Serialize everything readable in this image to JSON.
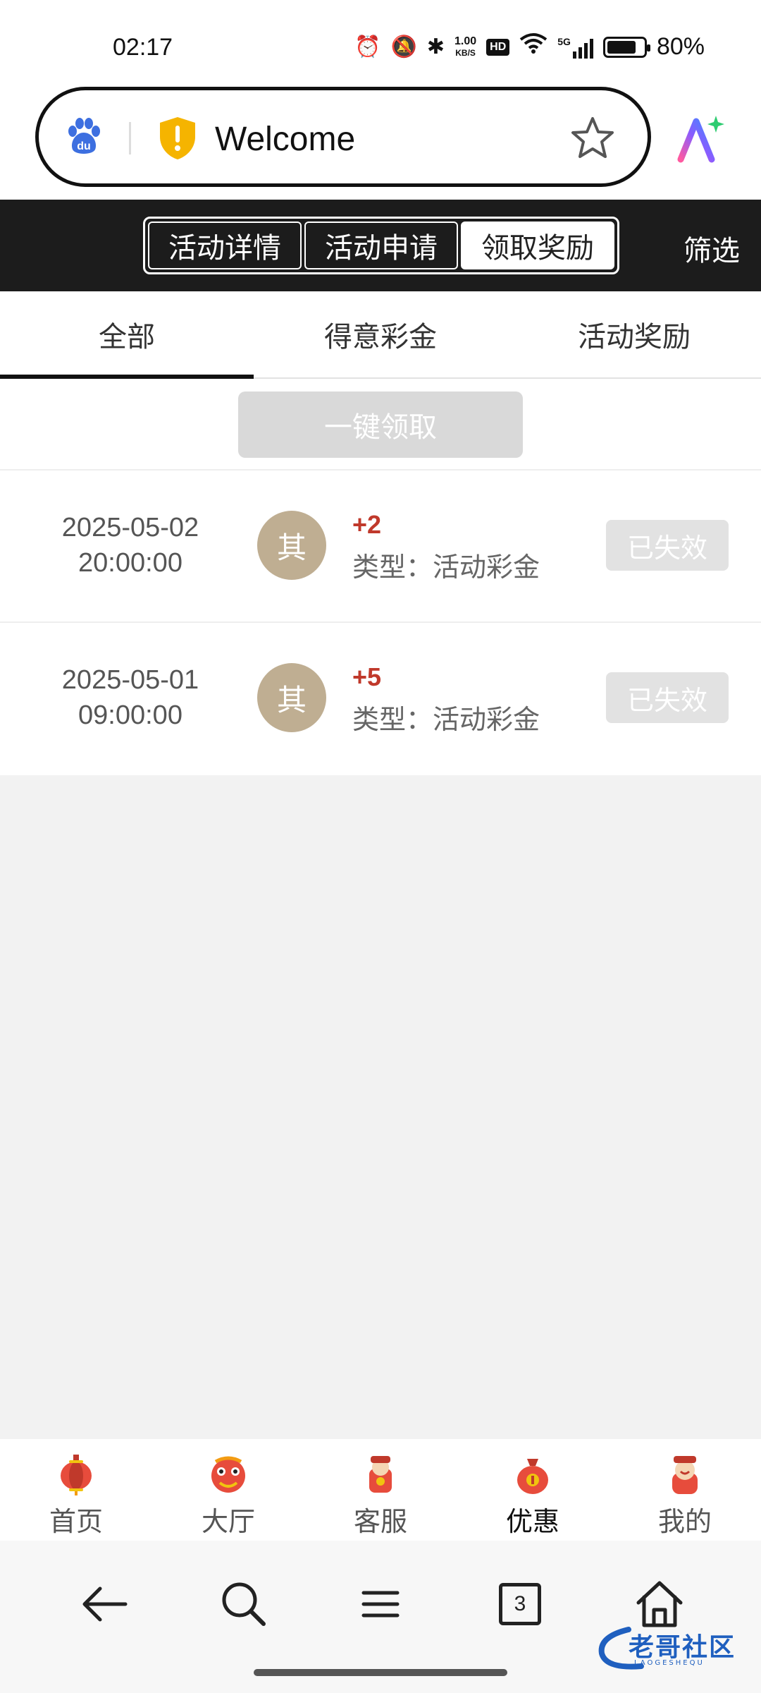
{
  "status_bar": {
    "time": "02:17",
    "net_speed_value": "1.00",
    "net_speed_unit": "KB/S",
    "hd": "HD",
    "signal_type": "5G",
    "battery_level": 0.8,
    "battery_percent": "80%"
  },
  "browser": {
    "url_title": "Welcome"
  },
  "header": {
    "segments": [
      "活动详情",
      "活动申请",
      "领取奖励"
    ],
    "active_segment": "领取奖励",
    "filter_label": "筛选"
  },
  "sub_tabs": {
    "items": [
      "全部",
      "得意彩金",
      "活动奖励"
    ],
    "active": "全部"
  },
  "claim_all_label": "一键领取",
  "records": [
    {
      "date": "2025-05-02",
      "time": "20:00:00",
      "badge": "其",
      "amount": "+2",
      "type": "类型：活动彩金",
      "status": "已失效"
    },
    {
      "date": "2025-05-01",
      "time": "09:00:00",
      "badge": "其",
      "amount": "+5",
      "type": "类型：活动彩金",
      "status": "已失效"
    }
  ],
  "app_nav": {
    "items": [
      "首页",
      "大厅",
      "客服",
      "优惠",
      "我的"
    ],
    "active": "优惠"
  },
  "browser_nav": {
    "tab_count": "3"
  },
  "watermark": {
    "text": "老哥社区",
    "sub": "LAOGESHEQU"
  },
  "colors": {
    "header_bg": "#1c1c1c",
    "amount": "#c0392b",
    "badge": "#bfae92",
    "disabled": "#d9d9d9"
  }
}
